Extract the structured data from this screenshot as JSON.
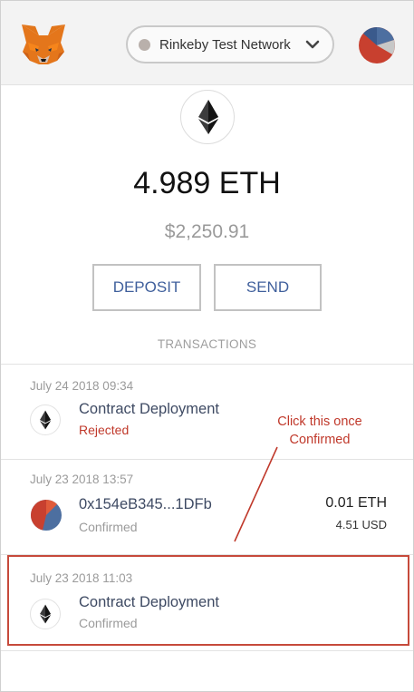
{
  "header": {
    "network_label": "Rinkeby Test Network",
    "network_dot_color": "#b9b0ab",
    "logo_icon": "metamask-fox-icon",
    "account_icon": "account-avatar-icon"
  },
  "wallet": {
    "balance": "4.989 ETH",
    "balance_fiat": "$2,250.91",
    "deposit_label": "DEPOSIT",
    "send_label": "SEND"
  },
  "transactions": {
    "heading": "TRANSACTIONS",
    "items": [
      {
        "date": "July 24 2018 09:34",
        "title": "Contract Deployment",
        "status": "Rejected",
        "icon": "ether-icon"
      },
      {
        "date": "July 23 2018 13:57",
        "title": "0x154eB345...1DFb",
        "status": "Confirmed",
        "amount": "0.01 ETH",
        "fiat": "4.51 USD",
        "icon": "recipient-avatar-icon"
      },
      {
        "date": "July 23 2018 11:03",
        "title": "Contract Deployment",
        "status": "Confirmed",
        "icon": "ether-icon"
      }
    ]
  },
  "annotation": {
    "text": "Click this once Confirmed",
    "color": "#c0392b"
  },
  "colors": {
    "accent_blue": "#3f5f9c",
    "rejected_red": "#c0392b",
    "highlight_border": "#c64a3b"
  }
}
